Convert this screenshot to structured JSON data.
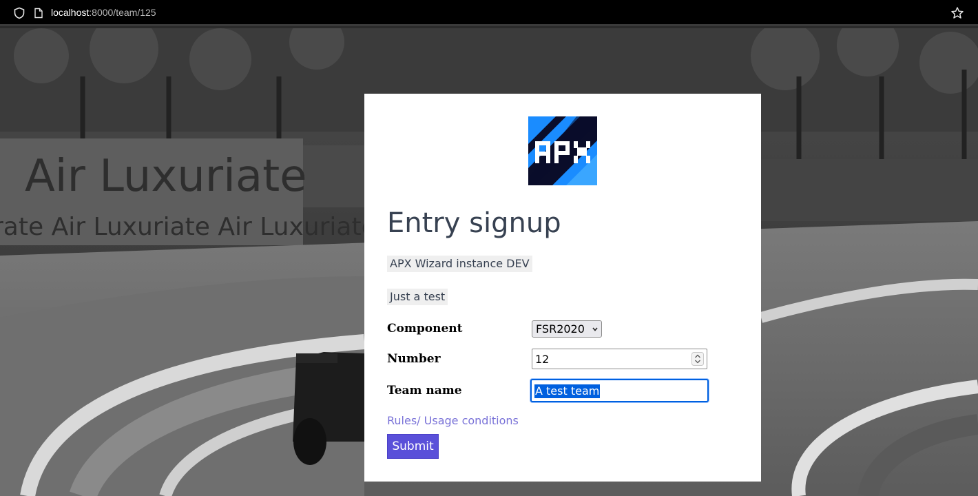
{
  "browser": {
    "url_host": "localhost",
    "url_path": ":8000/team/125"
  },
  "background": {
    "banner_text": "Air Luxuriate",
    "banner_repeat": "rate  Air Luxuriate  Air Luxuriate"
  },
  "logo": {
    "text": "APX",
    "colors": {
      "dark": "#0a0d2a",
      "blue": "#1a8cff",
      "light": "#5cc4ff"
    }
  },
  "page": {
    "title": "Entry signup",
    "instance": "APX Wizard instance DEV",
    "description": "Just a test"
  },
  "form": {
    "component_label": "Component",
    "component_value": "FSR2020",
    "number_label": "Number",
    "number_value": "12",
    "team_name_label": "Team name",
    "team_name_value": "A test team",
    "rules_link": "Rules/ Usage conditions",
    "submit_label": "Submit"
  },
  "colors": {
    "accent": "#5a50d9",
    "link": "#7a73d8",
    "focus": "#0060df",
    "title": "#374151"
  }
}
